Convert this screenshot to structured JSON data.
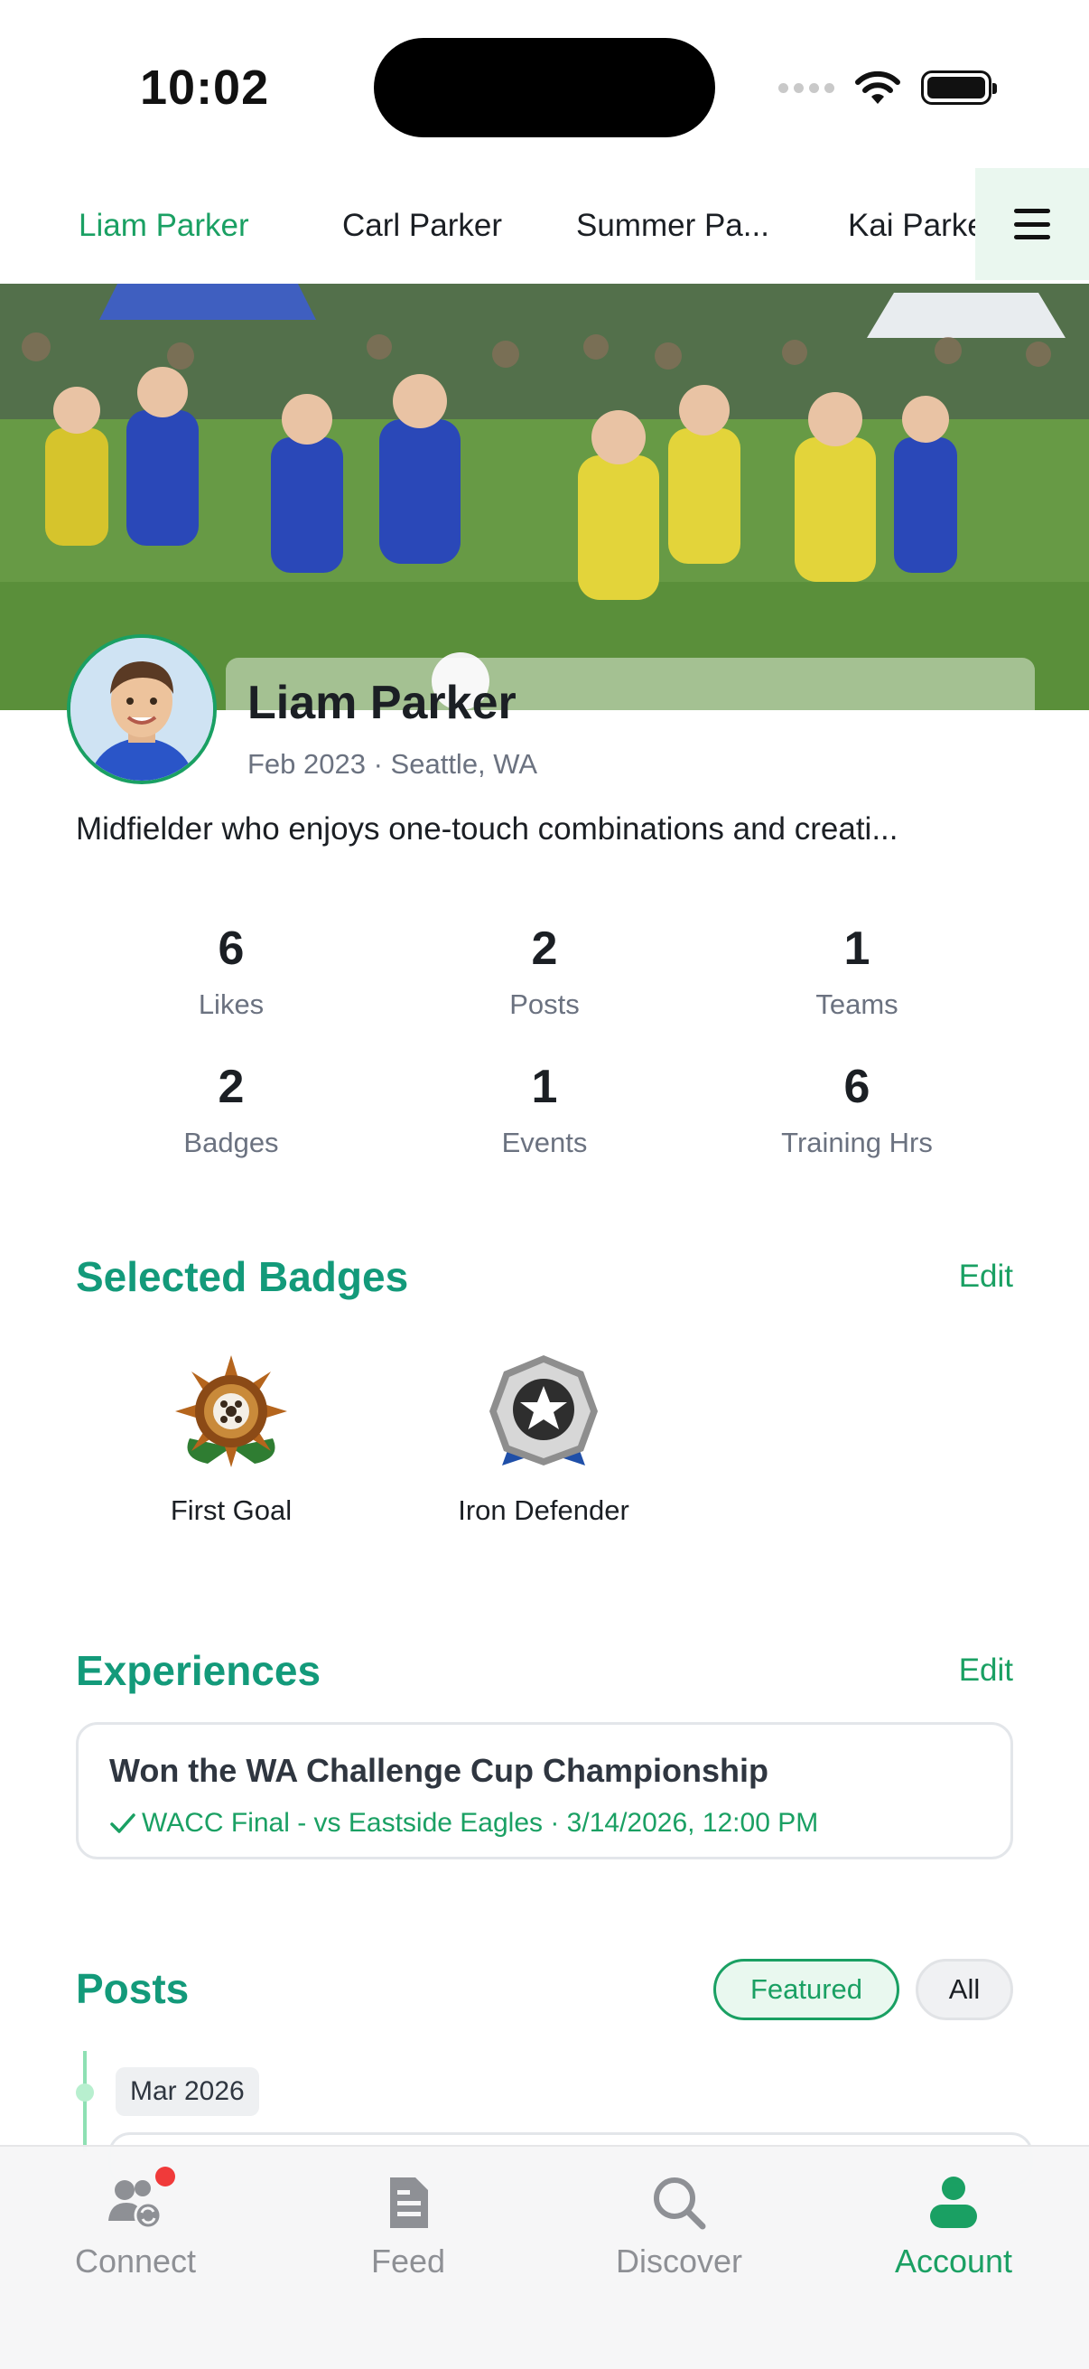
{
  "status_bar": {
    "time": "10:02"
  },
  "tabs": {
    "items": [
      {
        "label": "Liam Parker",
        "active": true
      },
      {
        "label": "Carl Parker",
        "active": false
      },
      {
        "label": "Summer Pa...",
        "active": false
      },
      {
        "label": "Kai Parke",
        "active": false
      }
    ],
    "menu_icon": "hamburger-icon"
  },
  "profile": {
    "name": "Liam Parker",
    "meta": "Feb 2023 · Seattle, WA",
    "bio": "Midfielder who enjoys one-touch combinations and creati..."
  },
  "stats": [
    {
      "value": "6",
      "label": "Likes"
    },
    {
      "value": "2",
      "label": "Posts"
    },
    {
      "value": "1",
      "label": "Teams"
    },
    {
      "value": "2",
      "label": "Badges"
    },
    {
      "value": "1",
      "label": "Events"
    },
    {
      "value": "6",
      "label": "Training Hrs"
    }
  ],
  "badges_section": {
    "title": "Selected Badges",
    "edit_label": "Edit",
    "items": [
      {
        "label": "First Goal",
        "icon": "sunburst-badge-icon"
      },
      {
        "label": "Iron Defender",
        "icon": "silver-star-badge-icon"
      }
    ]
  },
  "experiences_section": {
    "title": "Experiences",
    "edit_label": "Edit",
    "items": [
      {
        "title": "Won the WA Challenge Cup Championship",
        "subtitle": "WACC Final - vs Eastside Eagles · 3/14/2026, 12:00 PM"
      }
    ]
  },
  "posts_section": {
    "title": "Posts",
    "filters": [
      {
        "label": "Featured",
        "selected": true
      },
      {
        "label": "All",
        "selected": false
      }
    ],
    "timeline_date": "Mar 2026"
  },
  "bottom_nav": {
    "items": [
      {
        "label": "Connect",
        "icon": "connect-icon",
        "has_notification": true
      },
      {
        "label": "Feed",
        "icon": "feed-icon"
      },
      {
        "label": "Discover",
        "icon": "search-icon"
      },
      {
        "label": "Account",
        "icon": "account-icon",
        "active": true
      }
    ]
  },
  "colors": {
    "accent": "#1aa063",
    "section_title": "#139a7a",
    "notification": "#f03a3a"
  }
}
